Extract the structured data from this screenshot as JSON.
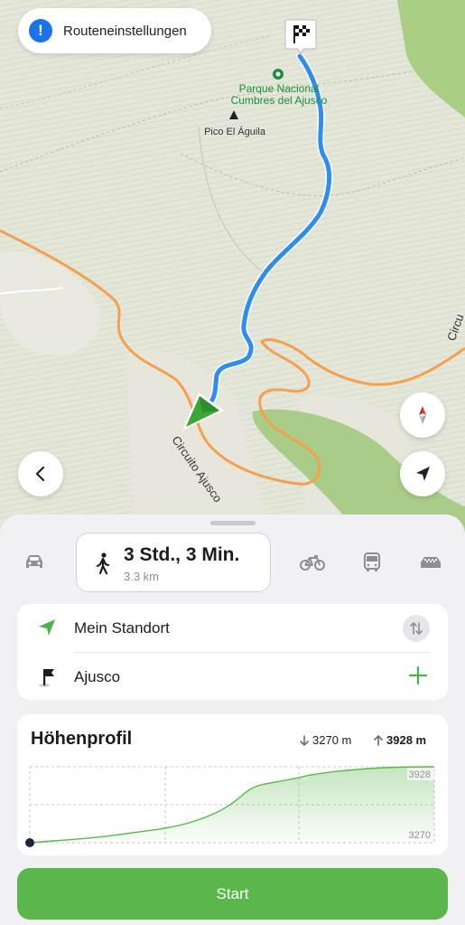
{
  "map": {
    "route_settings_label": "Routeneinstellungen",
    "park_name_line1": "Parque Nacional",
    "park_name_line2": "Cumbres del Ajusco",
    "peak_name": "Pico El Águila",
    "road_name": "Circuito Ajusco",
    "road_name_right": "Circu"
  },
  "modes": {
    "selected_time": "3 Std., 3 Min.",
    "selected_distance": "3.3 km",
    "items": [
      "car-icon",
      "walk-icon",
      "bike-icon",
      "bus-icon",
      "taxi-icon"
    ]
  },
  "waypoints": {
    "from": "Mein Standort",
    "to": "Ajusco"
  },
  "elevation": {
    "title": "Höhenprofil",
    "descent": "3270 m",
    "ascent": "3928 m",
    "max_label": "3928",
    "min_label": "3270"
  },
  "start_label": "Start",
  "colors": {
    "route": "#2f8df0",
    "road": "#f4a04e",
    "accent_green": "#5bb64b",
    "info_blue": "#1a73e8"
  }
}
